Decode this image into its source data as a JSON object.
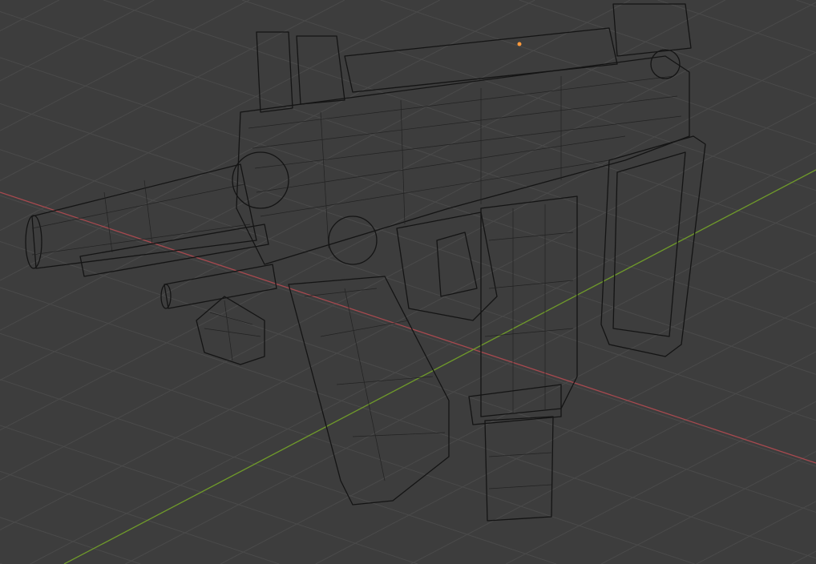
{
  "viewport": {
    "mode": "wireframe",
    "colors": {
      "background": "#3d3d3d",
      "grid": "#4a4a4a",
      "x_axis": "#a8494f",
      "y_axis": "#6f9a2a",
      "wire": "#141414",
      "origin": "#ff9a3c"
    }
  }
}
